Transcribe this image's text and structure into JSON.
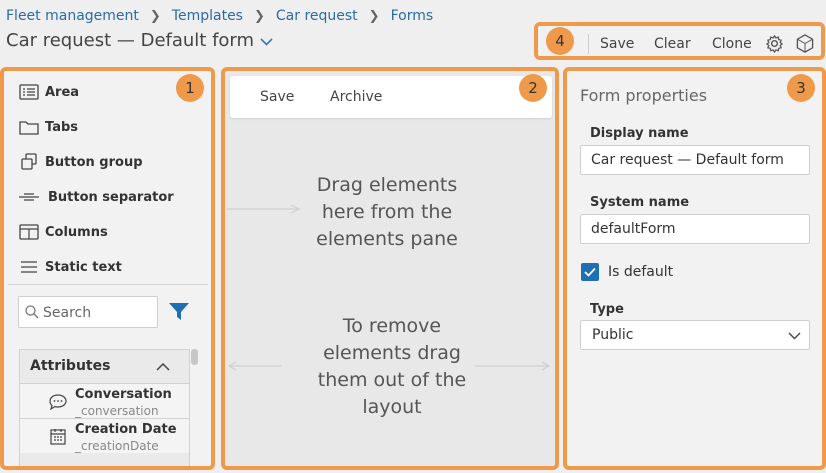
{
  "breadcrumb": [
    "Fleet management",
    "Templates",
    "Car request",
    "Forms"
  ],
  "page_title": "Car request — Default form",
  "toolbar": {
    "save": "Save",
    "clear": "Clear",
    "clone": "Clone",
    "badge": "4"
  },
  "elements_pane": {
    "badge": "1",
    "items": [
      {
        "label": "Area",
        "icon": "area-icon"
      },
      {
        "label": "Tabs",
        "icon": "tabs-icon"
      },
      {
        "label": "Button group",
        "icon": "button-group-icon"
      },
      {
        "label": "Button separator",
        "icon": "button-separator-icon"
      },
      {
        "label": "Columns",
        "icon": "columns-icon"
      },
      {
        "label": "Static text",
        "icon": "static-text-icon"
      }
    ],
    "search_placeholder": "Search",
    "attributes": {
      "title": "Attributes",
      "items": [
        {
          "name": "Conversation",
          "system": "_conversation",
          "icon": "chat-bubble-icon"
        },
        {
          "name": "Creation Date",
          "system": "_creationDate",
          "icon": "calendar-icon"
        }
      ]
    }
  },
  "layout_pane": {
    "badge": "2",
    "buttons": {
      "save": "Save",
      "archive": "Archive"
    },
    "hint_drag_line1": "Drag elements",
    "hint_drag_line2": "here from the",
    "hint_drag_line3": "elements pane",
    "hint_remove_line1": "To remove",
    "hint_remove_line2": "elements drag",
    "hint_remove_line3": "them out of the",
    "hint_remove_line4": "layout"
  },
  "properties_pane": {
    "badge": "3",
    "title": "Form properties",
    "display_name_label": "Display name",
    "display_name_value": "Car request — Default form",
    "system_name_label": "System name",
    "system_name_value": "defaultForm",
    "is_default_label": "Is default",
    "is_default_checked": true,
    "type_label": "Type",
    "type_value": "Public"
  },
  "colors": {
    "highlight": "#ef9a4a",
    "accent": "#1f6fb5",
    "link": "#2a6ba8"
  }
}
